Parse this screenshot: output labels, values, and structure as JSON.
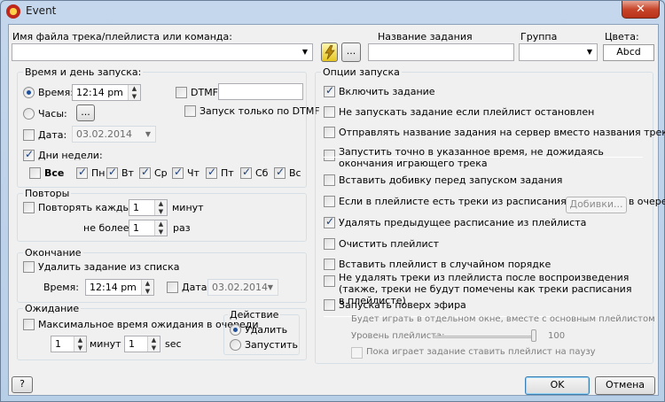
{
  "window": {
    "title": "Event",
    "close_symbol": "✕"
  },
  "header": {
    "track_label": "Имя файла трека/плейлиста или команда:",
    "track_value": "",
    "task_name_label": "Название задания",
    "task_name_value": "",
    "group_label": "Группа",
    "group_value": "",
    "colors_label": "Цвета:",
    "colors_button": "Abcd",
    "browse_button": "..."
  },
  "start": {
    "legend": "Время и день запуска:",
    "time_label": "Время:",
    "time_value": "12:14 pm",
    "clock_label": "Часы:",
    "clock_button": "...",
    "date_label": "Дата:",
    "date_value": "03.02.2014",
    "weekdays_label": "Дни недели:",
    "all_label": "Все",
    "days": [
      "Пн",
      "Вт",
      "Ср",
      "Чт",
      "Пт",
      "Сб",
      "Вс"
    ],
    "dtmf_label": "DTMF",
    "dtmf_value": "",
    "dtmf_only_label": "Запуск только по DTMF"
  },
  "repeat": {
    "legend": "Повторы",
    "every_label": "Повторять каждые",
    "every_value": "1",
    "every_unit": "минут",
    "max_label": "не более",
    "max_value": "1",
    "max_unit": "раз"
  },
  "end": {
    "legend": "Окончание",
    "remove_label": "Удалить задание из списка",
    "time_label": "Время:",
    "time_value": "12:14 pm",
    "date_label": "Дата:",
    "date_value": "03.02.2014"
  },
  "wait": {
    "legend": "Ожидание",
    "max_wait_label": "Максимальное время ожидания в очереди",
    "minutes_value": "1",
    "minutes_unit": "минут",
    "seconds_value": "1",
    "seconds_unit": "sec",
    "action_legend": "Действие",
    "action_delete": "Удалить",
    "action_run": "Запустить"
  },
  "options": {
    "legend": "Опции запуска",
    "enable": "Включить задание",
    "no_run_stopped": "Не запускать задание если плейлист остановлен",
    "send_name": "Отправлять название задания на сервер вместо названия треков",
    "run_exact": "Запустить точно в указанное время, не дожидаясь окончания играющего трека",
    "insert_jingle": "Вставить добивку перед запуском задания",
    "jingles_button": "Добивки...",
    "queue_if_sched": "Если в плейлисте есть треки из расписания, поставить в очередь",
    "delete_prev": "Удалять предыдущее расписание из плейлиста",
    "clear_playlist": "Очистить плейлист",
    "insert_random": "Вставить плейлист в случайном порядке",
    "no_delete_tracks": "Не удалять треки из плейлиста после воспроизведения (также, треки не будут помечены как треки расписания в плейлисте)",
    "overlay": "Запускать поверх эфира",
    "overlay_note": "Будет играть в отдельном окне, вместе с основным плейлистом",
    "level_label": "Уровень плейлиста:",
    "level_value": "100",
    "pause_label": "Пока играет задание ставить плейлист на паузу"
  },
  "footer": {
    "help_button": "?",
    "ok_button": "OK",
    "cancel_button": "Отмена"
  },
  "state": {
    "time_radio": true,
    "clock_radio": false,
    "date_check": false,
    "weekdays_check": true,
    "all_check": false,
    "days_checked": [
      true,
      true,
      true,
      true,
      true,
      true,
      true
    ],
    "dtmf_check": false,
    "dtmf_only_check": false,
    "repeat_check": false,
    "remove_check": false,
    "end_date_check": false,
    "max_wait_check": false,
    "action_delete": true,
    "opt_checked": [
      true,
      false,
      false,
      false,
      false,
      false,
      true,
      false,
      false,
      false,
      false,
      false
    ],
    "level_percent": 100
  }
}
